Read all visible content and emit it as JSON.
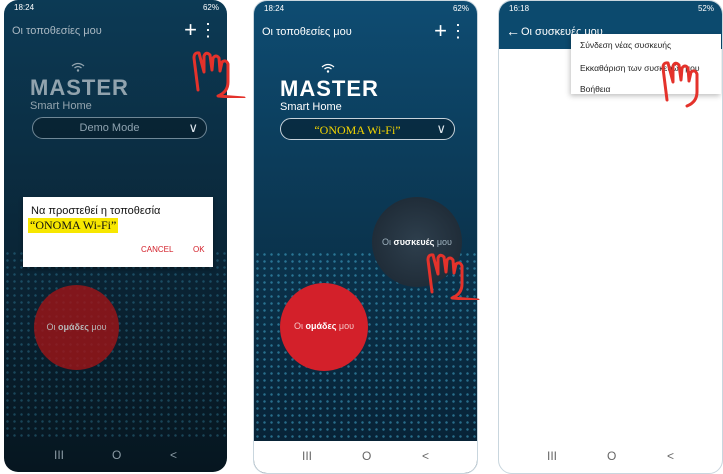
{
  "colors": {
    "accent_red": "#d3202a",
    "highlight": "#f7e700",
    "dark_blue": "#0a2333"
  },
  "screen1": {
    "status": {
      "time": "18:24",
      "signal": "62%"
    },
    "appbar": {
      "title": "Οι τοποθεσίες μου",
      "add_icon": "plus-icon",
      "menu_icon": "more-vert-icon"
    },
    "logo": {
      "brand": "MASTER",
      "sub": "Smart Home"
    },
    "location_selector": {
      "value": "Demo Mode"
    },
    "dialog": {
      "line1": "Να προστεθεί η τοποθεσία",
      "line2": "“ONOMA Wi-Fi”",
      "cancel": "CANCEL",
      "ok": "OK"
    },
    "groups_button": {
      "prefix": "Οι ",
      "bold": "ομάδες",
      "suffix": " μου"
    }
  },
  "screen2": {
    "status": {
      "time": "18:24",
      "signal": "62%"
    },
    "appbar": {
      "title": "Οι τοποθεσίες μου",
      "add_icon": "plus-icon",
      "menu_icon": "more-vert-icon"
    },
    "logo": {
      "brand": "MASTER",
      "sub": "Smart Home"
    },
    "location_selector": {
      "value": "“ONOMA Wi-Fi”"
    },
    "devices_button": {
      "prefix": "Οι ",
      "bold": "συσκευές",
      "suffix": " μου"
    },
    "groups_button": {
      "prefix": "Οι ",
      "bold": "ομάδες",
      "suffix": " μου"
    }
  },
  "screen3": {
    "status": {
      "time": "16:18",
      "signal": "52%"
    },
    "appbar": {
      "title": "Οι συσκευές μου",
      "back_icon": "arrow-back-icon"
    },
    "menu": {
      "items": [
        "Σύνδεση νέας συσκευής",
        "Εκκαθάριση των συσκευών μου",
        "Βοήθεια"
      ]
    }
  },
  "navbar": {
    "recents": "III",
    "home": "O",
    "back": "<"
  }
}
